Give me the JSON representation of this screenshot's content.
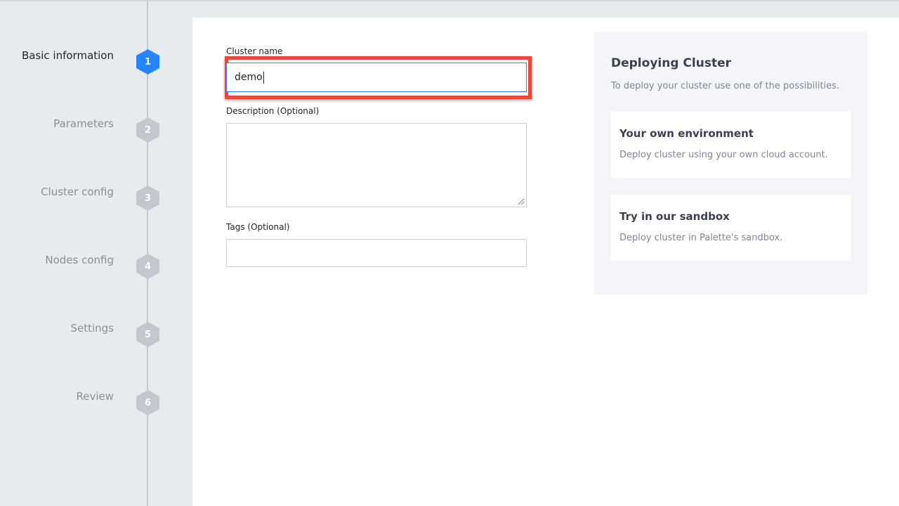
{
  "steps": [
    {
      "label": "Basic information",
      "number": "1",
      "state": "active"
    },
    {
      "label": "Parameters",
      "number": "2",
      "state": "pending"
    },
    {
      "label": "Cluster config",
      "number": "3",
      "state": "pending"
    },
    {
      "label": "Nodes config",
      "number": "4",
      "state": "pending"
    },
    {
      "label": "Settings",
      "number": "5",
      "state": "pending"
    },
    {
      "label": "Review",
      "number": "6",
      "state": "pending"
    }
  ],
  "form": {
    "cluster_name_label": "Cluster name",
    "cluster_name_value": "demo",
    "description_label": "Description (Optional)",
    "description_value": "",
    "tags_label": "Tags (Optional)",
    "tags_value": ""
  },
  "info": {
    "title": "Deploying Cluster",
    "subtitle": "To deploy your cluster use one of the possibilities.",
    "options": [
      {
        "title": "Your own environment",
        "description": "Deploy cluster using your own cloud account."
      },
      {
        "title": "Try in our sandbox",
        "description": "Deploy cluster in Palette's sandbox."
      }
    ]
  },
  "colors": {
    "active_step": "#2684ff",
    "inactive_step": "#c3c8cf",
    "highlight": "#e8493e"
  }
}
